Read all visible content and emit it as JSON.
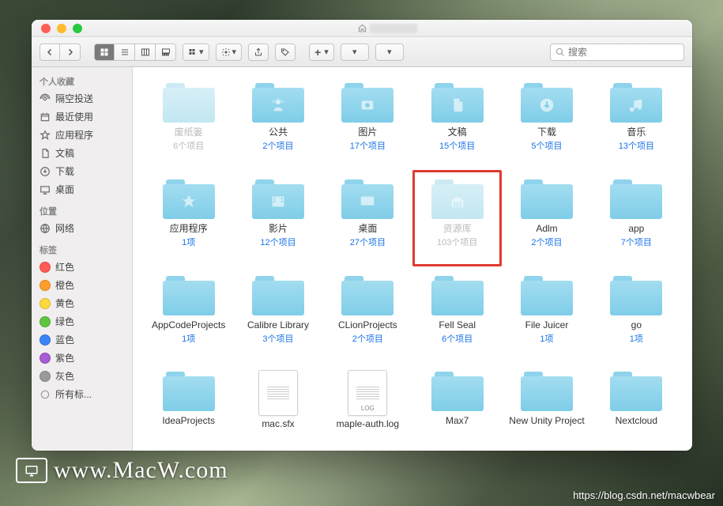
{
  "search": {
    "placeholder": "搜索"
  },
  "sidebar": {
    "sections": [
      {
        "header": "个人收藏",
        "items": [
          {
            "label": "隔空投送",
            "icon": "airdrop"
          },
          {
            "label": "最近使用",
            "icon": "recent"
          },
          {
            "label": "应用程序",
            "icon": "apps"
          },
          {
            "label": "文稿",
            "icon": "docs"
          },
          {
            "label": "下载",
            "icon": "downloads"
          },
          {
            "label": "桌面",
            "icon": "desktop"
          }
        ]
      },
      {
        "header": "位置",
        "items": [
          {
            "label": "网络",
            "icon": "network"
          }
        ]
      },
      {
        "header": "标签",
        "items": [
          {
            "label": "红色",
            "color": "#ff5b56"
          },
          {
            "label": "橙色",
            "color": "#ff9e2c"
          },
          {
            "label": "黄色",
            "color": "#ffd93a"
          },
          {
            "label": "绿色",
            "color": "#5ec53f"
          },
          {
            "label": "蓝色",
            "color": "#3a82f7"
          },
          {
            "label": "紫色",
            "color": "#a65cd4"
          },
          {
            "label": "灰色",
            "color": "#9a9a9a"
          },
          {
            "label": "所有标...",
            "icon": "alltags"
          }
        ]
      }
    ]
  },
  "items": [
    {
      "name": "废纸篓",
      "sub": "6个项目",
      "type": "folder",
      "glyph": "",
      "dimmed": true
    },
    {
      "name": "公共",
      "sub": "2个项目",
      "type": "folder",
      "glyph": "public"
    },
    {
      "name": "图片",
      "sub": "17个项目",
      "type": "folder",
      "glyph": "pictures"
    },
    {
      "name": "文稿",
      "sub": "15个项目",
      "type": "folder",
      "glyph": "documents"
    },
    {
      "name": "下载",
      "sub": "5个项目",
      "type": "folder",
      "glyph": "downloads"
    },
    {
      "name": "音乐",
      "sub": "13个项目",
      "type": "folder",
      "glyph": "music"
    },
    {
      "name": "应用程序",
      "sub": "1项",
      "type": "folder",
      "glyph": "apps"
    },
    {
      "name": "影片",
      "sub": "12个项目",
      "type": "folder",
      "glyph": "movies"
    },
    {
      "name": "桌面",
      "sub": "27个项目",
      "type": "folder",
      "glyph": "desktop"
    },
    {
      "name": "资源库",
      "sub": "103个项目",
      "type": "folder",
      "glyph": "library",
      "dimmed": true,
      "highlighted": true
    },
    {
      "name": "Adlm",
      "sub": "2个项目",
      "type": "folder"
    },
    {
      "name": "app",
      "sub": "7个项目",
      "type": "folder"
    },
    {
      "name": "AppCodeProjects",
      "sub": "1项",
      "type": "folder"
    },
    {
      "name": "Calibre Library",
      "sub": "3个项目",
      "type": "folder"
    },
    {
      "name": "CLionProjects",
      "sub": "2个项目",
      "type": "folder"
    },
    {
      "name": "Fell Seal",
      "sub": "6个项目",
      "type": "folder"
    },
    {
      "name": "File Juicer",
      "sub": "1项",
      "type": "folder"
    },
    {
      "name": "go",
      "sub": "1项",
      "type": "folder"
    },
    {
      "name": "IdeaProjects",
      "sub": "",
      "type": "folder"
    },
    {
      "name": "mac.sfx",
      "sub": "",
      "type": "file"
    },
    {
      "name": "maple-auth.log",
      "sub": "",
      "type": "file-log"
    },
    {
      "name": "Max7",
      "sub": "",
      "type": "folder"
    },
    {
      "name": "New Unity Project",
      "sub": "",
      "type": "folder"
    },
    {
      "name": "Nextcloud",
      "sub": "",
      "type": "folder"
    }
  ],
  "watermark": "www.MacW.com",
  "footer": "https://blog.csdn.net/macwbear"
}
